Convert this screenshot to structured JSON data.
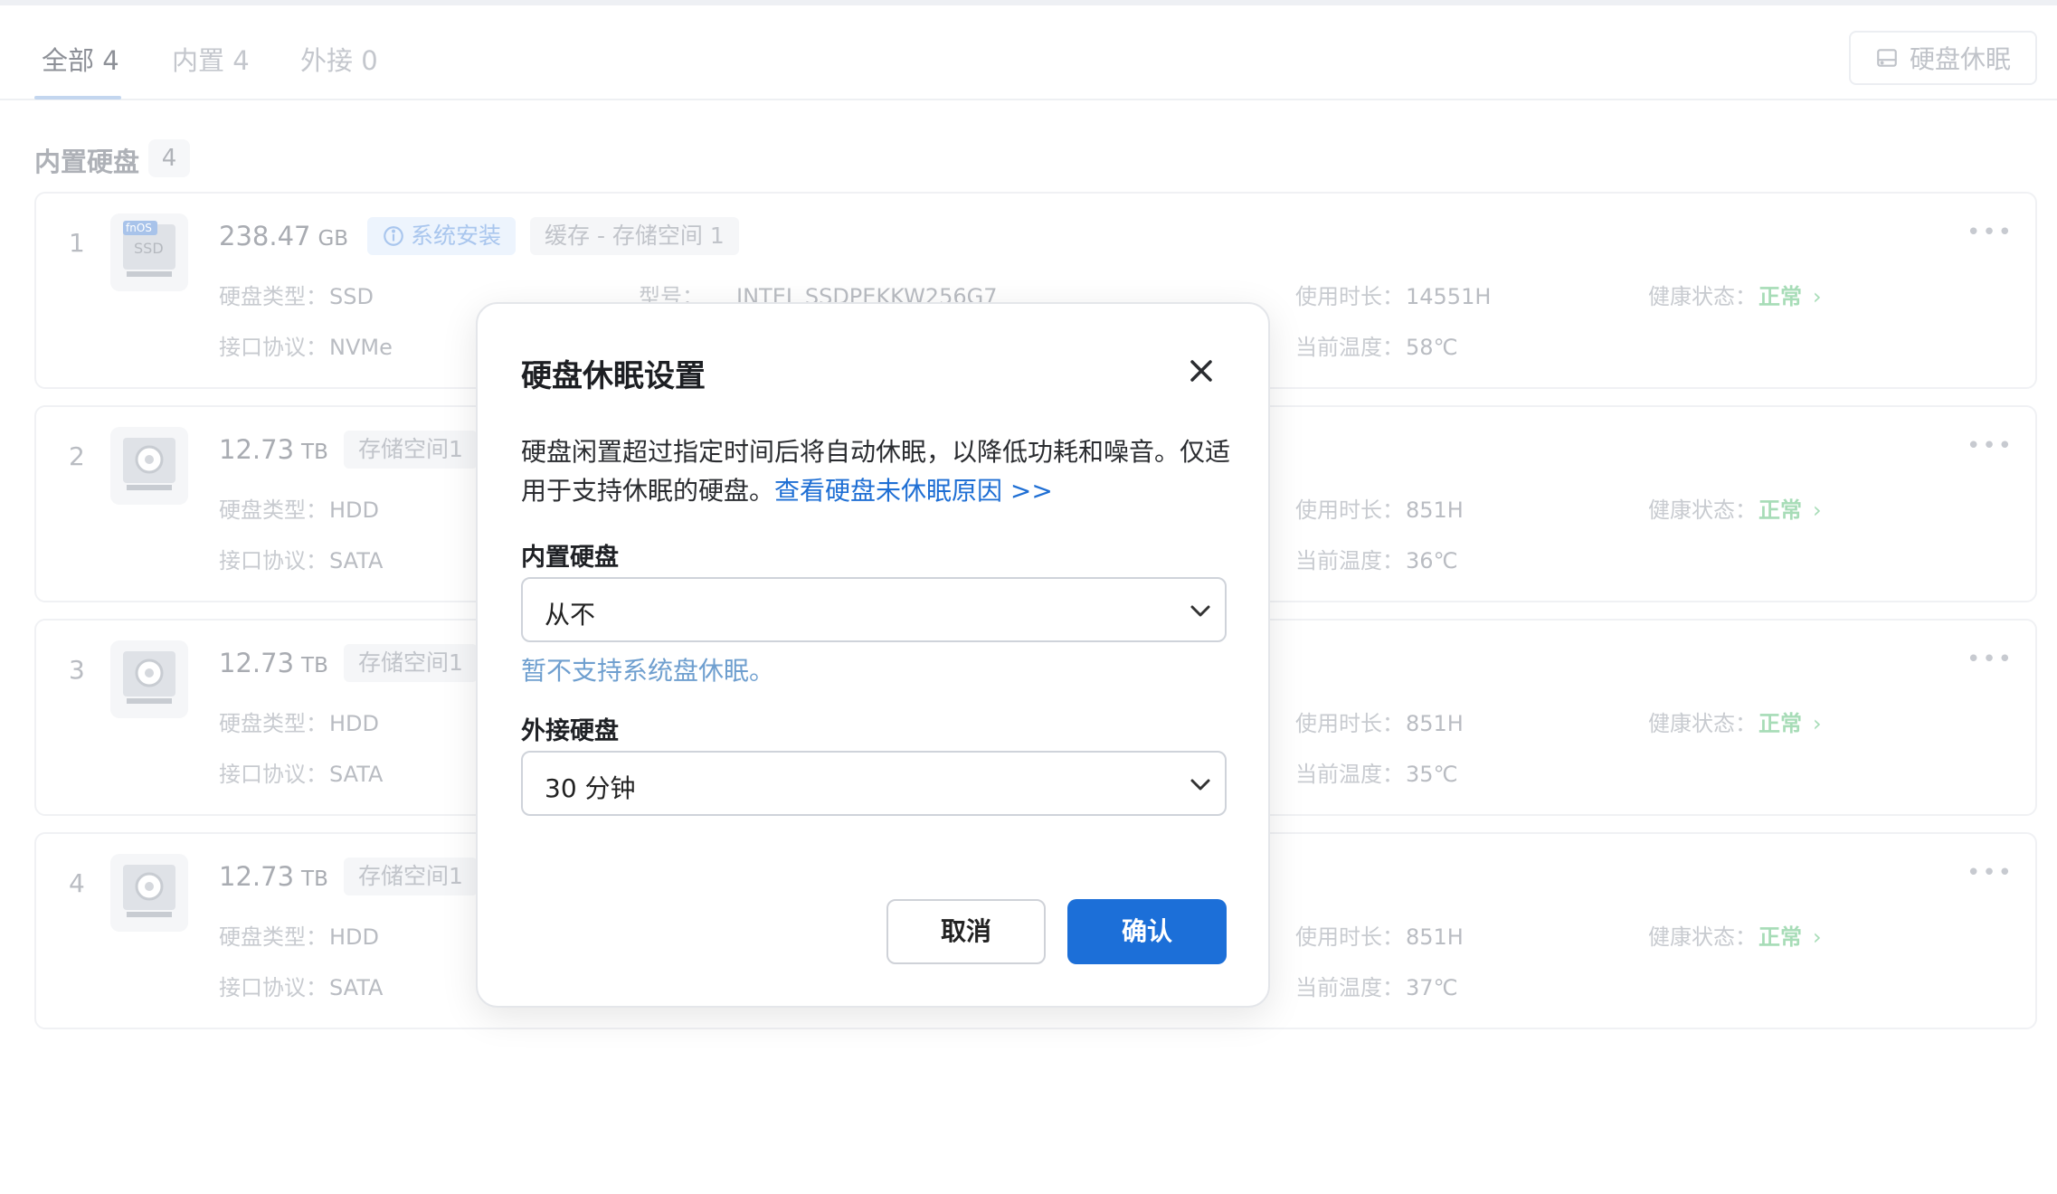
{
  "tabs": [
    {
      "label": "全部 4"
    },
    {
      "label": "内置 4"
    },
    {
      "label": "外接 0"
    }
  ],
  "header": {
    "sleep_button": "硬盘休眠",
    "sleep_icon": "hard-drive-icon"
  },
  "section": {
    "title": "内置硬盘",
    "count": "4"
  },
  "disks": [
    {
      "index": "1",
      "capacity": "238.47",
      "unit": "GB",
      "icon": "ssd-icon",
      "icon_badge": "fnOS",
      "icon_text": "SSD",
      "tags": [
        "系统安装",
        "缓存 - 存储空间 1"
      ],
      "type_label": "硬盘类型：",
      "type": "SSD",
      "iface_label": "接口协议：",
      "iface": "NVMe",
      "model_label": "型号：",
      "model": "INTEL SSDPEKKW256G7",
      "hours_label": "使用时长：",
      "hours": "14551H",
      "temp_label": "当前温度：",
      "temp": "58℃",
      "health_label": "健康状态：",
      "health": "正常"
    },
    {
      "index": "2",
      "capacity": "12.73",
      "unit": "TB",
      "icon": "hdd-icon",
      "tags": [
        "存储空间1"
      ],
      "type_label": "硬盘类型：",
      "type": "HDD",
      "iface_label": "接口协议：",
      "iface": "SATA",
      "hours_label": "使用时长：",
      "hours": "851H",
      "temp_label": "当前温度：",
      "temp": "36℃",
      "health_label": "健康状态：",
      "health": "正常"
    },
    {
      "index": "3",
      "capacity": "12.73",
      "unit": "TB",
      "icon": "hdd-icon",
      "tags": [
        "存储空间1"
      ],
      "type_label": "硬盘类型：",
      "type": "HDD",
      "iface_label": "接口协议：",
      "iface": "SATA",
      "hours_label": "使用时长：",
      "hours": "851H",
      "temp_label": "当前温度：",
      "temp": "35℃",
      "health_label": "健康状态：",
      "health": "正常"
    },
    {
      "index": "4",
      "capacity": "12.73",
      "unit": "TB",
      "icon": "hdd-icon",
      "tags": [
        "存储空间1"
      ],
      "type_label": "硬盘类型：",
      "type": "HDD",
      "iface_label": "接口协议：",
      "iface": "SATA",
      "hours_label": "使用时长：",
      "hours": "851H",
      "temp_label": "当前温度：",
      "temp": "37℃",
      "health_label": "健康状态：",
      "health": "正常"
    }
  ],
  "modal": {
    "title": "硬盘休眠设置",
    "desc": "硬盘闲置超过指定时间后将自动休眠，以降低功耗和噪音。仅适用于支持休眠的硬盘。",
    "link": "查看硬盘未休眠原因 >>",
    "internal_label": "内置硬盘",
    "internal_value": "从不",
    "internal_hint": "暂不支持系统盘休眠。",
    "external_label": "外接硬盘",
    "external_value": "30 分钟",
    "cancel": "取消",
    "confirm": "确认"
  },
  "colors": {
    "accent": "#1c6fd8",
    "link": "#1f6fd4",
    "health": "#a7dcb7",
    "hint": "#6f9fcf"
  }
}
